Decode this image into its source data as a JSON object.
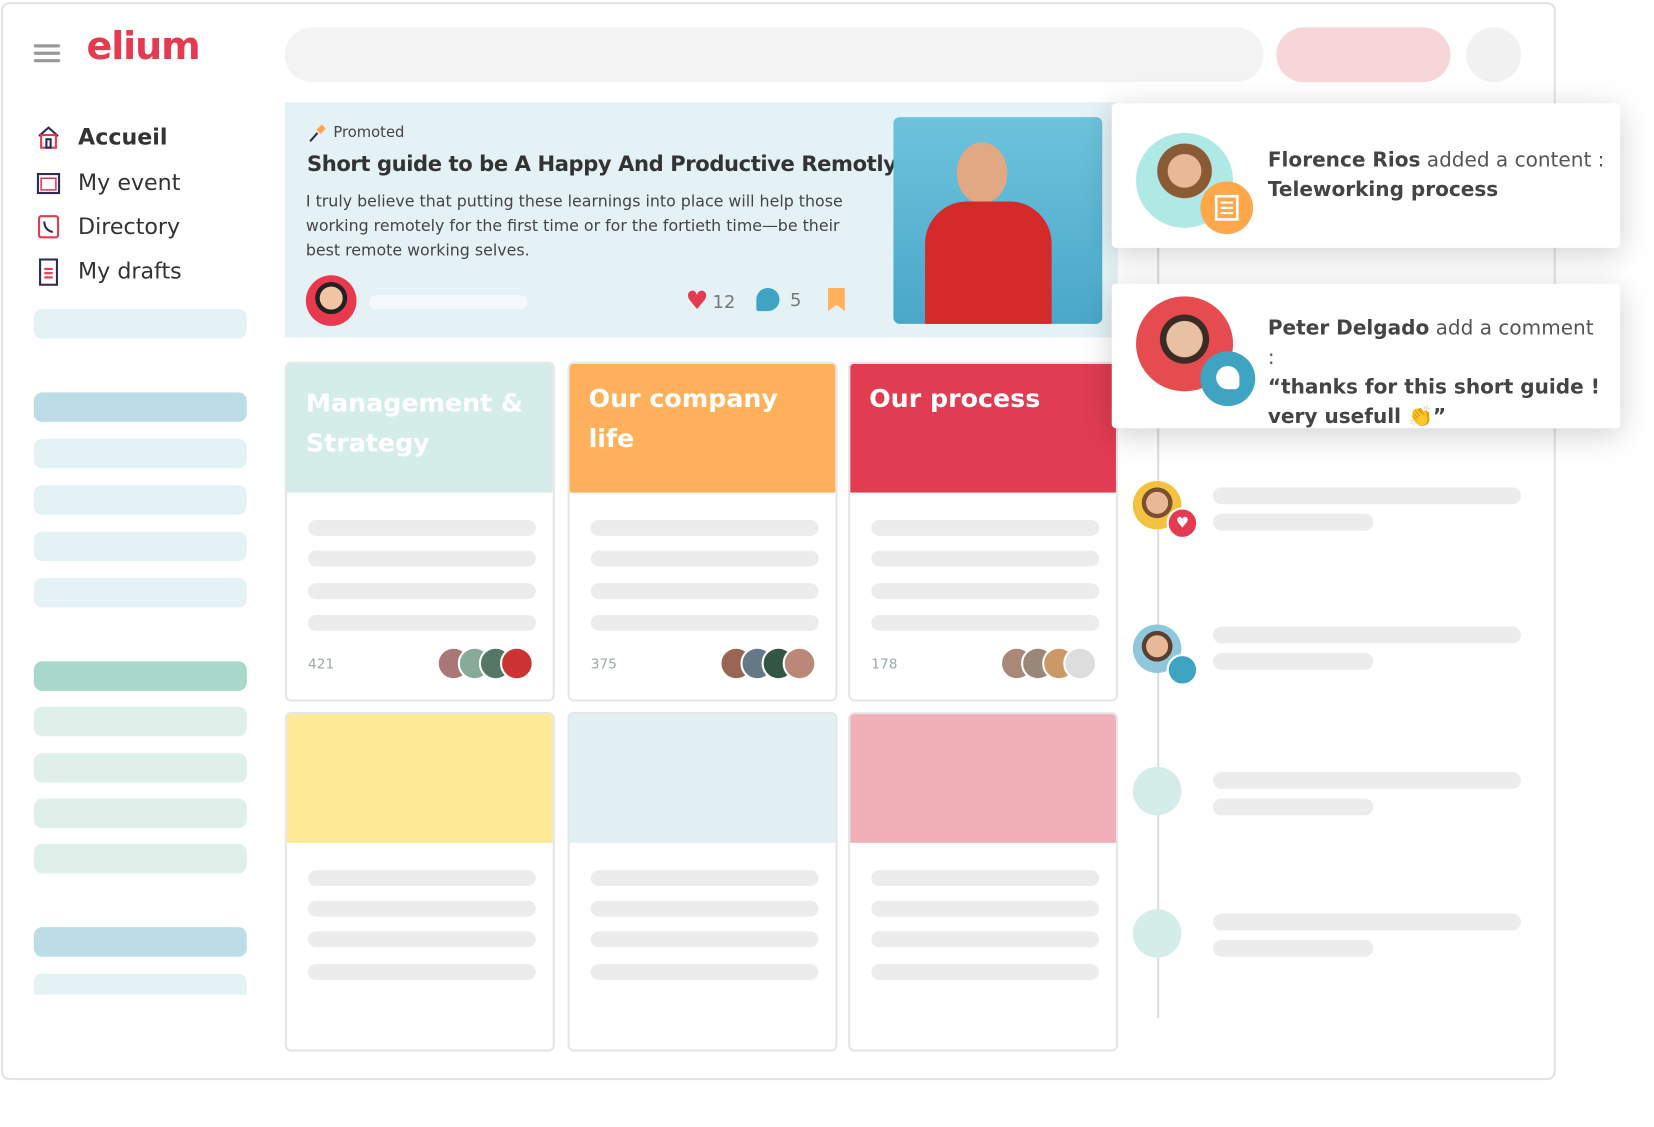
{
  "brand": {
    "logo": "elium",
    "color": "#e63a50"
  },
  "sidebar": {
    "items": [
      {
        "label": "Accueil",
        "icon": "home-icon",
        "active": true
      },
      {
        "label": "My event",
        "icon": "calendar-icon"
      },
      {
        "label": "Directory",
        "icon": "phone-book-icon"
      },
      {
        "label": "My drafts",
        "icon": "draft-icon"
      }
    ]
  },
  "promoted": {
    "badge": "Promoted",
    "title": "Short guide to be A Happy And Productive Remotly",
    "excerpt": "I truly believe that putting these learnings into place will help those working remotely for the first time or for the fortieth time—be their best remote working selves.",
    "likes": "12",
    "comments": "5"
  },
  "categories": [
    {
      "title": "Management & Strategy",
      "count": "421",
      "color": "#d4ede8"
    },
    {
      "title": "Our company life",
      "count": "375",
      "color": "#ffb05a"
    },
    {
      "title": "Our process",
      "count": "178",
      "color": "#e03c52"
    },
    {
      "title": "",
      "color": "#fde996"
    },
    {
      "title": "",
      "color": "#e2eff3"
    },
    {
      "title": "",
      "color": "#f1afb8"
    }
  ],
  "notifications": [
    {
      "name": "Florence Rios",
      "action": "added a content :",
      "detail": "Teleworking process",
      "badge_icon": "article-icon",
      "badge_color": "#ffa84a"
    },
    {
      "name": "Peter Delgado",
      "action": "add a comment :",
      "detail": "“thanks for this short guide ! very usefull 👏”",
      "badge_icon": "comment-icon",
      "badge_color": "#3fa3c2"
    }
  ]
}
